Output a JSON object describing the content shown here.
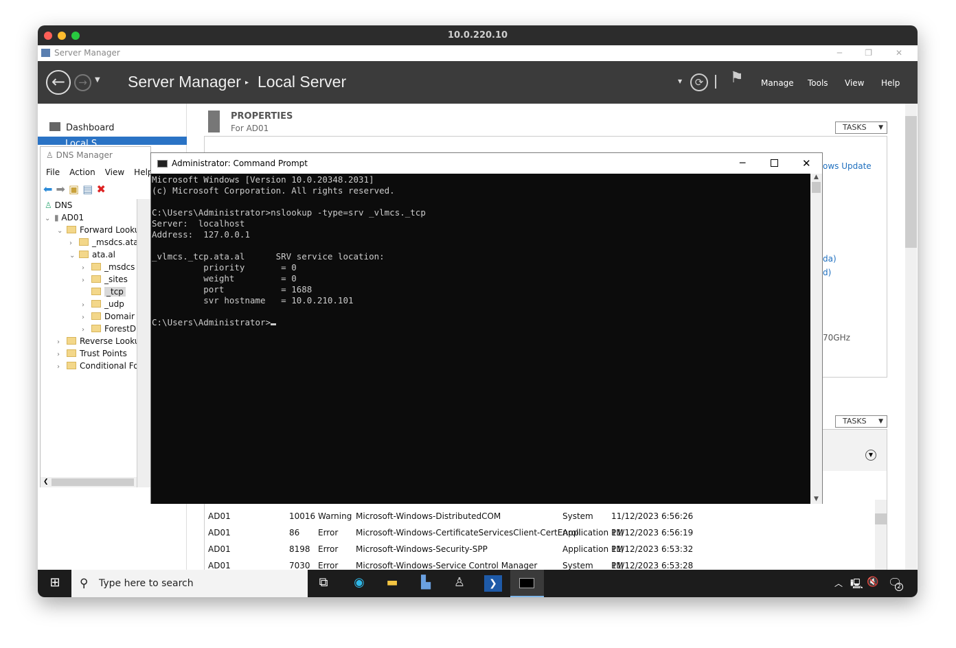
{
  "mac": {
    "title": "10.0.220.10"
  },
  "server_manager": {
    "window_title": "Server Manager",
    "breadcrumb": [
      "Server Manager",
      "Local Server"
    ],
    "menu": [
      "Manage",
      "Tools",
      "View",
      "Help"
    ],
    "sidebar": {
      "items": [
        {
          "label": "Dashboard"
        },
        {
          "label": "Local S"
        }
      ]
    },
    "properties": {
      "title": "PROPERTIES",
      "subtitle": "For AD01",
      "tasks": "TASKS"
    },
    "fragments": [
      "ows Update",
      "da)",
      "d)",
      "70GHz"
    ],
    "tasks2": "TASKS",
    "events": {
      "rows": [
        {
          "server": "AD01",
          "id": "10016",
          "severity": "Warning",
          "source": "Microsoft-Windows-DistributedCOM",
          "log": "System",
          "date": "11/12/2023 6:56:26 PM"
        },
        {
          "server": "AD01",
          "id": "86",
          "severity": "Error",
          "source": "Microsoft-Windows-CertificateServicesClient-CertEnroll",
          "log": "Application",
          "date": "11/12/2023 6:56:19 PM"
        },
        {
          "server": "AD01",
          "id": "8198",
          "severity": "Error",
          "source": "Microsoft-Windows-Security-SPP",
          "log": "Application",
          "date": "11/12/2023 6:53:32 PM"
        },
        {
          "server": "AD01",
          "id": "7030",
          "severity": "Error",
          "source": "Microsoft-Windows-Service Control Manager",
          "log": "System",
          "date": "11/12/2023 6:53:28 PM"
        }
      ]
    }
  },
  "dns_manager": {
    "title": "DNS Manager",
    "menu": [
      "File",
      "Action",
      "View",
      "Help"
    ],
    "tree": [
      "DNS",
      "AD01",
      "Forward Looku",
      "_msdcs.ata",
      "ata.al",
      "_msdcs",
      "_sites",
      "_tcp",
      "_udp",
      "Domair",
      "ForestD",
      "Reverse Looku",
      "Trust Points",
      "Conditional Fo"
    ]
  },
  "cmd": {
    "title": "Administrator: Command Prompt",
    "lines": "Microsoft Windows [Version 10.0.20348.2031]\n(c) Microsoft Corporation. All rights reserved.\n\nC:\\Users\\Administrator>nslookup -type=srv _vlmcs._tcp\nServer:  localhost\nAddress:  127.0.0.1\n\n_vlmcs._tcp.ata.al      SRV service location:\n          priority       = 0\n          weight         = 0\n          port           = 1688\n          svr hostname   = 10.0.210.101\n\nC:\\Users\\Administrator>"
  },
  "taskbar": {
    "search_placeholder": "Type here to search",
    "notification_count": "2"
  }
}
